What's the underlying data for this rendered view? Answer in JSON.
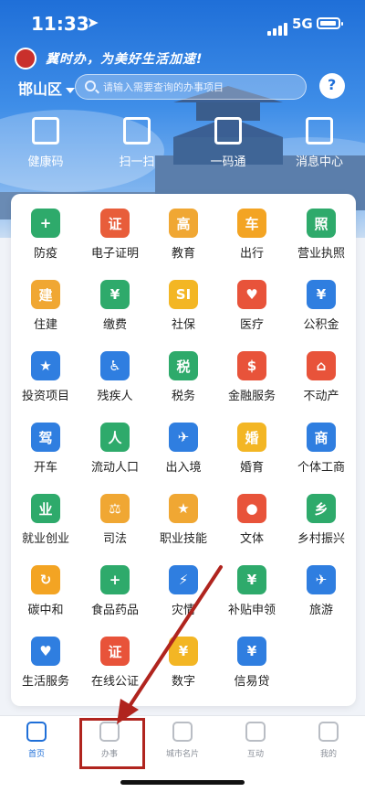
{
  "status_bar": {
    "time": "11:33",
    "network": "5G"
  },
  "header": {
    "slogan": "冀时办，为美好生活加速!",
    "region": "邯山区",
    "search_placeholder": "请输入需要查询的办事项目"
  },
  "quick_actions": [
    {
      "label": "健康码",
      "icon": "health-code-icon"
    },
    {
      "label": "扫一扫",
      "icon": "scan-icon"
    },
    {
      "label": "一码通",
      "icon": "barcode-icon"
    },
    {
      "label": "消息中心",
      "icon": "message-icon"
    }
  ],
  "services": [
    {
      "label": "防疫",
      "icon": "shield-plus-icon",
      "color": "#2eaa6b",
      "glyph": "+"
    },
    {
      "label": "电子证明",
      "icon": "certificate-icon",
      "color": "#e85d3a",
      "glyph": "证"
    },
    {
      "label": "教育",
      "icon": "education-icon",
      "color": "#f0a733",
      "glyph": "高"
    },
    {
      "label": "出行",
      "icon": "bus-icon",
      "color": "#f3a423",
      "glyph": "车"
    },
    {
      "label": "营业执照",
      "icon": "license-icon",
      "color": "#2eaa6b",
      "glyph": "照"
    },
    {
      "label": "住建",
      "icon": "building-icon",
      "color": "#f0a733",
      "glyph": "建"
    },
    {
      "label": "缴费",
      "icon": "payment-icon",
      "color": "#2eaa6b",
      "glyph": "¥"
    },
    {
      "label": "社保",
      "icon": "social-security-icon",
      "color": "#f3b624",
      "glyph": "SI"
    },
    {
      "label": "医疗",
      "icon": "heart-pulse-icon",
      "color": "#e8533a",
      "glyph": "♥"
    },
    {
      "label": "公积金",
      "icon": "housing-fund-icon",
      "color": "#2f7ee0",
      "glyph": "¥"
    },
    {
      "label": "投资项目",
      "icon": "investment-icon",
      "color": "#2f7ee0",
      "glyph": "★"
    },
    {
      "label": "残疾人",
      "icon": "wheelchair-icon",
      "color": "#2f7ee0",
      "glyph": "♿"
    },
    {
      "label": "税务",
      "icon": "tax-icon",
      "color": "#2eaa6b",
      "glyph": "税"
    },
    {
      "label": "金融服务",
      "icon": "finance-icon",
      "color": "#e8533a",
      "glyph": "$"
    },
    {
      "label": "不动产",
      "icon": "house-icon",
      "color": "#e8533a",
      "glyph": "⌂"
    },
    {
      "label": "开车",
      "icon": "driver-icon",
      "color": "#2f7ee0",
      "glyph": "驾"
    },
    {
      "label": "流动人口",
      "icon": "migrant-icon",
      "color": "#2eaa6b",
      "glyph": "人"
    },
    {
      "label": "出入境",
      "icon": "airplane-globe-icon",
      "color": "#2f7ee0",
      "glyph": "✈"
    },
    {
      "label": "婚育",
      "icon": "couple-icon",
      "color": "#f3b624",
      "glyph": "婚"
    },
    {
      "label": "个体工商",
      "icon": "shop-icon",
      "color": "#2f7ee0",
      "glyph": "商"
    },
    {
      "label": "就业创业",
      "icon": "tie-icon",
      "color": "#2eaa6b",
      "glyph": "业"
    },
    {
      "label": "司法",
      "icon": "scales-icon",
      "color": "#f0a733",
      "glyph": "⚖"
    },
    {
      "label": "职业技能",
      "icon": "skill-certificate-icon",
      "color": "#f0a733",
      "glyph": "★"
    },
    {
      "label": "文体",
      "icon": "basketball-icon",
      "color": "#e8533a",
      "glyph": "●"
    },
    {
      "label": "乡村振兴",
      "icon": "rural-revival-icon",
      "color": "#2eaa6b",
      "glyph": "乡"
    },
    {
      "label": "碳中和",
      "icon": "recycle-icon",
      "color": "#f3a423",
      "glyph": "↻"
    },
    {
      "label": "食品药品",
      "icon": "medicine-icon",
      "color": "#2eaa6b",
      "glyph": "+"
    },
    {
      "label": "灾情",
      "icon": "disaster-icon",
      "color": "#2f7ee0",
      "glyph": "⚡"
    },
    {
      "label": "补贴申领",
      "icon": "subsidy-icon",
      "color": "#2eaa6b",
      "glyph": "¥"
    },
    {
      "label": "旅游",
      "icon": "airplane-icon",
      "color": "#2f7ee0",
      "glyph": "✈"
    },
    {
      "label": "生活服务",
      "icon": "hands-heart-icon",
      "color": "#2f7ee0",
      "glyph": "♥"
    },
    {
      "label": "在线公证",
      "icon": "gavel-icon",
      "color": "#e8533a",
      "glyph": "证"
    },
    {
      "label": "数字",
      "icon": "yuan-coin-icon",
      "color": "#f3b624",
      "glyph": "¥"
    },
    {
      "label": "信易贷",
      "icon": "loan-icon",
      "color": "#2f7ee0",
      "glyph": "¥"
    }
  ],
  "tabbar": [
    {
      "label": "首页",
      "icon": "home-icon",
      "active": true
    },
    {
      "label": "办事",
      "icon": "document-icon",
      "active": false
    },
    {
      "label": "城市名片",
      "icon": "city-card-icon",
      "active": false
    },
    {
      "label": "互动",
      "icon": "heart-icon",
      "active": false
    },
    {
      "label": "我的",
      "icon": "profile-icon",
      "active": false
    }
  ],
  "colors": {
    "primary": "#1f6fd8",
    "annotation": "#b0241e"
  }
}
